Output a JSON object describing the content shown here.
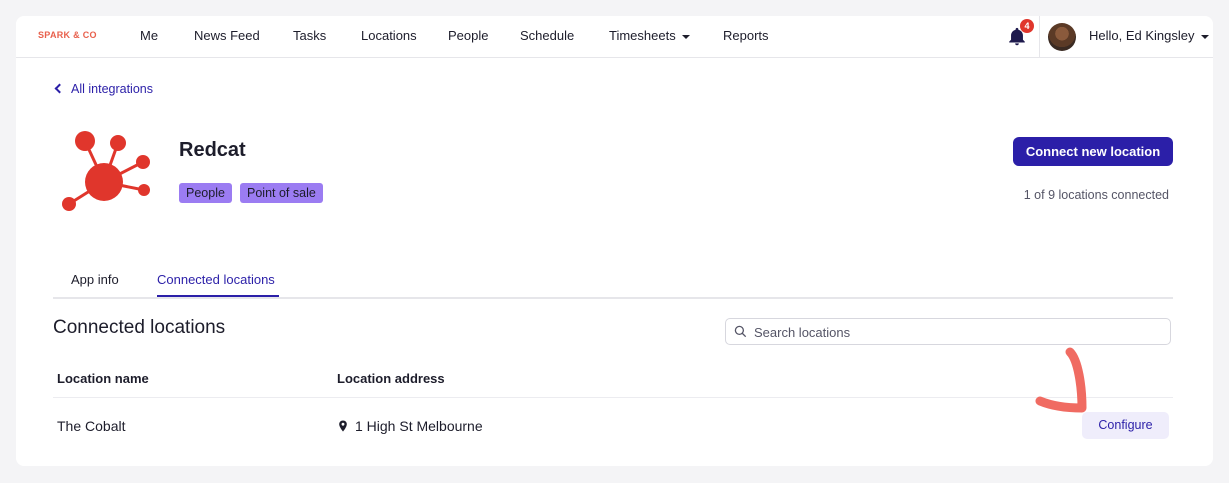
{
  "nav": {
    "brand": "SPARK & CO",
    "items": [
      "Me",
      "News Feed",
      "Tasks",
      "Locations",
      "People",
      "Schedule",
      "Timesheets",
      "Reports"
    ],
    "notification_count": "4",
    "greeting": "Hello, Ed Kingsley"
  },
  "page": {
    "back_link": "All integrations",
    "app_name": "Redcat",
    "tags": [
      "People",
      "Point of sale"
    ],
    "connect_button": "Connect new location",
    "location_count": "1 of 9 locations connected"
  },
  "tabs": [
    "App info",
    "Connected locations"
  ],
  "active_tab": "Connected locations",
  "section": {
    "title": "Connected locations",
    "search_placeholder": "Search locations"
  },
  "table": {
    "headers": [
      "Location name",
      "Location address"
    ],
    "rows": [
      {
        "name": "The Cobalt",
        "address": "1 High St Melbourne",
        "action": "Configure"
      }
    ]
  },
  "colors": {
    "accent": "#2b1fa8",
    "tag": "#9b7cf2",
    "brand": "#e8604c",
    "logo": "#e0362c",
    "badge": "#e0362c",
    "annotation": "#f06b62"
  },
  "icons": [
    "bell-icon",
    "chevron-left-icon",
    "search-icon",
    "location-pin-icon",
    "caret-down-icon"
  ]
}
